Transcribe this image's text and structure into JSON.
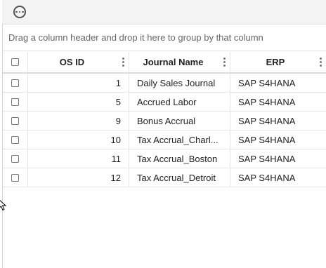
{
  "toolbar": {
    "menu_icon": "ellipsis-circle-icon"
  },
  "group_panel": {
    "text": "Drag a column header and drop it here to group by that column"
  },
  "columns": [
    {
      "label": "OS ID"
    },
    {
      "label": "Journal Name"
    },
    {
      "label": "ERP"
    }
  ],
  "rows": [
    {
      "os_id": "1",
      "journal_name": "Daily Sales Journal",
      "erp": "SAP S4HANA"
    },
    {
      "os_id": "5",
      "journal_name": "Accrued Labor",
      "erp": "SAP S4HANA"
    },
    {
      "os_id": "9",
      "journal_name": "Bonus Accrual",
      "erp": "SAP S4HANA"
    },
    {
      "os_id": "10",
      "journal_name": "Tax Accrual_Charl...",
      "erp": "SAP S4HANA"
    },
    {
      "os_id": "11",
      "journal_name": "Tax Accrual_Boston",
      "erp": "SAP S4HANA"
    },
    {
      "os_id": "12",
      "journal_name": "Tax Accrual_Detroit",
      "erp": "SAP S4HANA"
    }
  ],
  "colors": {
    "toolbar_bg": "#f3f3f3",
    "grid_border": "#e6e6e6"
  }
}
